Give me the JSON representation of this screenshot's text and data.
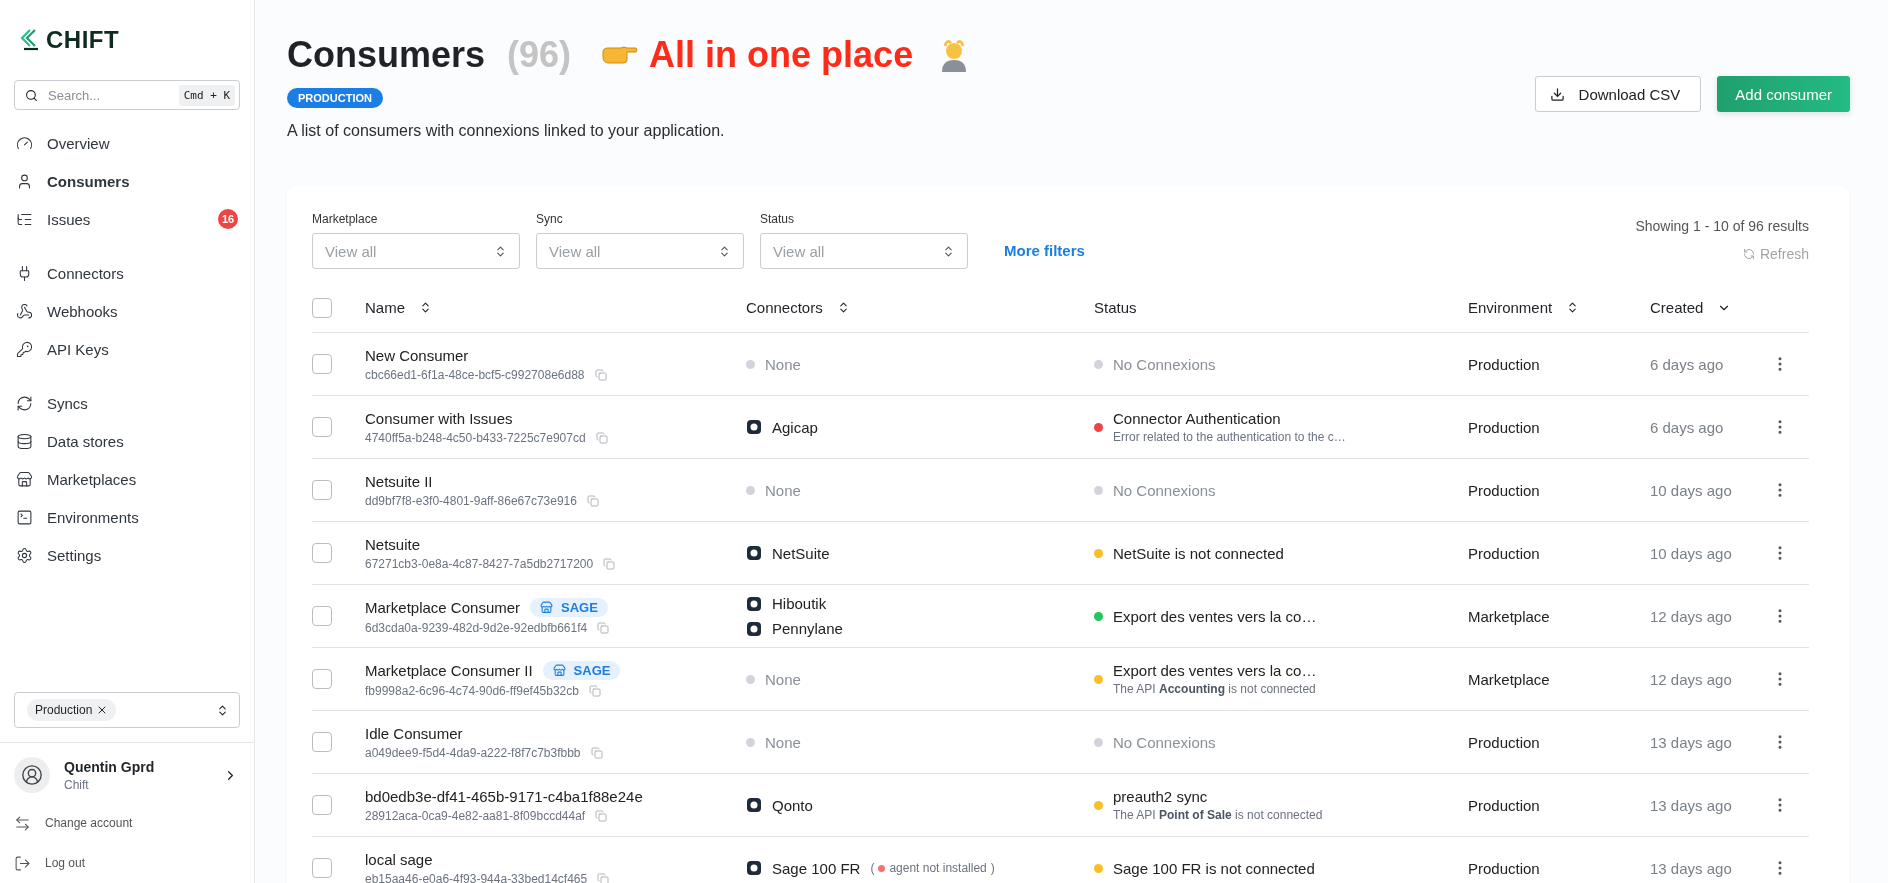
{
  "sidebar": {
    "logo": "CHIFT",
    "search": {
      "placeholder": "Search...",
      "shortcut": "Cmd + K"
    },
    "groups": [
      [
        {
          "label": "Overview",
          "selected": false
        },
        {
          "label": "Consumers",
          "selected": true
        },
        {
          "label": "Issues",
          "selected": false,
          "badge": "16"
        }
      ],
      [
        {
          "label": "Connectors",
          "selected": false
        },
        {
          "label": "Webhooks",
          "selected": false
        },
        {
          "label": "API Keys",
          "selected": false
        }
      ],
      [
        {
          "label": "Syncs",
          "selected": false
        },
        {
          "label": "Data stores",
          "selected": false
        },
        {
          "label": "Marketplaces",
          "selected": false
        },
        {
          "label": "Environments",
          "selected": false
        },
        {
          "label": "Settings",
          "selected": false
        }
      ]
    ],
    "environment_select": {
      "chip": "Production"
    },
    "user": {
      "name": "Quentin Gprd",
      "org": "Chift"
    },
    "actions": [
      "Change account",
      "Log out"
    ]
  },
  "header": {
    "title": "Consumers",
    "count": "(96)",
    "tagline": "All in one place",
    "badge": "PRODUCTION",
    "description": "A list of consumers with connexions linked to your application.",
    "buttons": {
      "download": "Download CSV",
      "add": "Add consumer"
    }
  },
  "filters": [
    {
      "label": "Marketplace",
      "placeholder": "View all"
    },
    {
      "label": "Sync",
      "placeholder": "View all"
    },
    {
      "label": "Status",
      "placeholder": "View all"
    }
  ],
  "more_filters": "More filters",
  "results": "Showing 1 - 10 of 96 results",
  "refresh": "Refresh",
  "table": {
    "select_all": {
      "checked": false
    },
    "columns": [
      {
        "label": "Name",
        "sortable": true,
        "sorted": false
      },
      {
        "label": "Connectors",
        "sortable": true,
        "sorted": false
      },
      {
        "label": "Status",
        "sortable": false
      },
      {
        "label": "Environment",
        "sortable": true,
        "sorted": false
      },
      {
        "label": "Created",
        "sortable": true,
        "sorted": true
      }
    ],
    "rows": [
      {
        "checked": false,
        "name": "New Consumer",
        "id": "cbc66ed1-6f1a-48ce-bcf5-c992708e6d88",
        "connectors": [
          {
            "kind": "none",
            "name": "None"
          }
        ],
        "status": {
          "color": "#d1d5db",
          "title": "No Connexions",
          "muted": true
        },
        "environment": "Production",
        "created": "6 days ago"
      },
      {
        "checked": false,
        "name": "Consumer with Issues",
        "id": "4740ff5a-b248-4c50-b433-7225c7e907cd",
        "connectors": [
          {
            "kind": "app",
            "name": "Agicap"
          }
        ],
        "status": {
          "color": "#ef4444",
          "title": "Connector Authentication",
          "detail": "Error related to the authentication to the c…",
          "muted": false
        },
        "environment": "Production",
        "created": "6 days ago"
      },
      {
        "checked": false,
        "name": "Netsuite II",
        "id": "dd9bf7f8-e3f0-4801-9aff-86e67c73e916",
        "connectors": [
          {
            "kind": "none",
            "name": "None"
          }
        ],
        "status": {
          "color": "#d1d5db",
          "title": "No Connexions",
          "muted": true
        },
        "environment": "Production",
        "created": "10 days ago"
      },
      {
        "checked": false,
        "name": "Netsuite",
        "id": "67271cb3-0e8a-4c87-8427-7a5db2717200",
        "connectors": [
          {
            "kind": "app",
            "name": "NetSuite"
          }
        ],
        "status": {
          "color": "#fbbf24",
          "title": "NetSuite is not connected",
          "muted": false
        },
        "environment": "Production",
        "created": "10 days ago"
      },
      {
        "checked": false,
        "name": "Marketplace Consumer",
        "tag": "SAGE",
        "id": "6d3cda0a-9239-482d-9d2e-92edbfb661f4",
        "connectors": [
          {
            "kind": "app",
            "name": "Hiboutik"
          },
          {
            "kind": "app",
            "name": "Pennylane"
          }
        ],
        "status": {
          "color": "#22c55e",
          "title": "Export des ventes vers la co…",
          "muted": false
        },
        "environment": "Marketplace",
        "created": "12 days ago"
      },
      {
        "checked": false,
        "name": "Marketplace Consumer II",
        "tag": "SAGE",
        "id": "fb9998a2-6c96-4c74-90d6-ff9ef45b32cb",
        "connectors": [
          {
            "kind": "none",
            "name": "None"
          }
        ],
        "status": {
          "color": "#fbbf24",
          "title": "Export des ventes vers la co…",
          "detail": "The API **Accounting** is not connected",
          "muted": false
        },
        "environment": "Marketplace",
        "created": "12 days ago"
      },
      {
        "checked": false,
        "name": "Idle Consumer",
        "id": "a049dee9-f5d4-4da9-a222-f8f7c7b3fbbb",
        "connectors": [
          {
            "kind": "none",
            "name": "None"
          }
        ],
        "status": {
          "color": "#d1d5db",
          "title": "No Connexions",
          "muted": true
        },
        "environment": "Production",
        "created": "13 days ago"
      },
      {
        "checked": false,
        "name": "bd0edb3e-df41-465b-9171-c4ba1f88e24e",
        "id": "28912aca-0ca9-4e82-aa81-8f09bccd44af",
        "connectors": [
          {
            "kind": "app",
            "name": "Qonto"
          }
        ],
        "status": {
          "color": "#fbbf24",
          "title": "preauth2 sync",
          "detail": "The API **Point of Sale** is not connected",
          "muted": false
        },
        "environment": "Production",
        "created": "13 days ago"
      },
      {
        "checked": false,
        "name": "local sage",
        "id": "eb15aa46-e0a6-4f93-944a-33bed14cf465",
        "connectors": [
          {
            "kind": "app",
            "name": "Sage 100 FR",
            "note": {
              "open": "(",
              "text": "agent not installed",
              "close": ")",
              "color": "#f87171"
            }
          }
        ],
        "status": {
          "color": "#fbbf24",
          "title": "Sage 100 FR is not connected",
          "muted": false
        },
        "environment": "Production",
        "created": "13 days ago"
      }
    ]
  }
}
